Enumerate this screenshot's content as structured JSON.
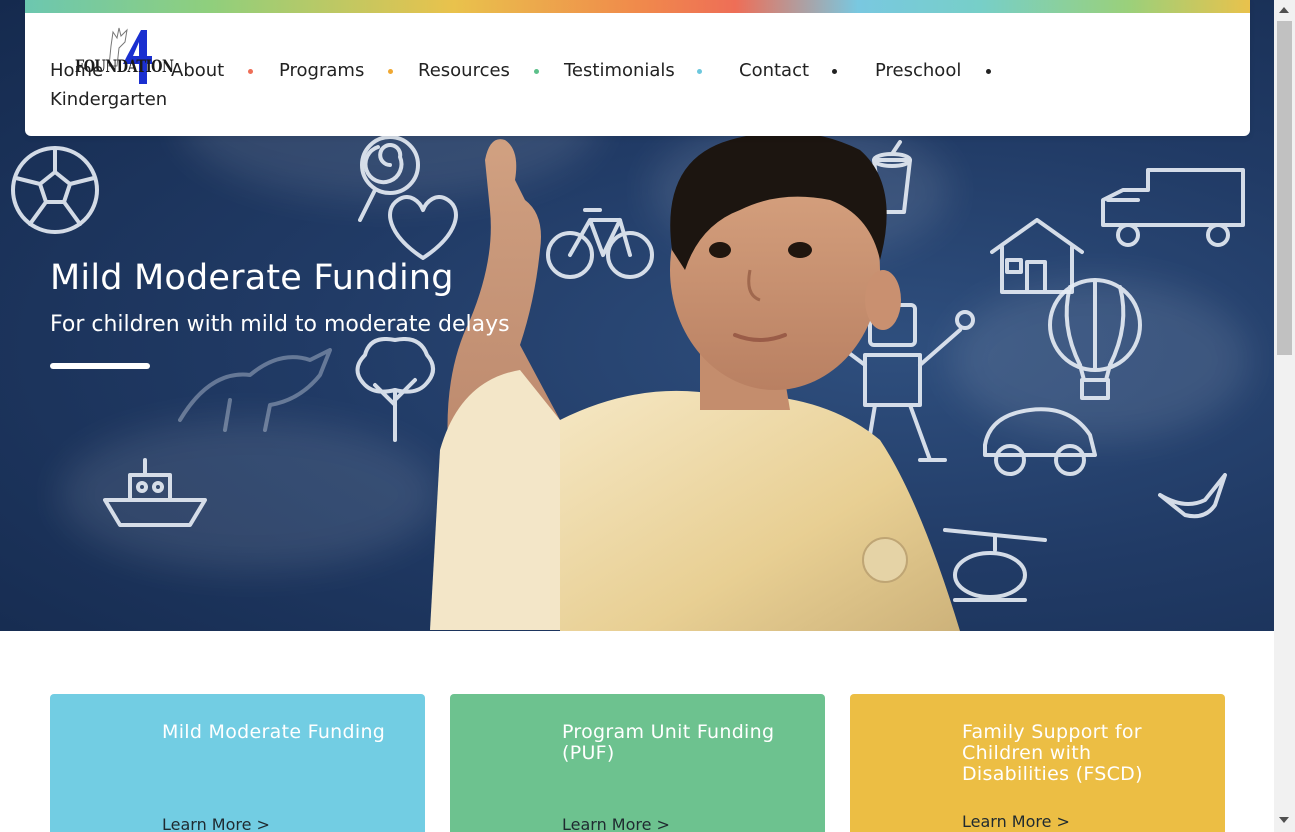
{
  "logo": {
    "text": "FOUNDATION",
    "numeral": "4"
  },
  "nav": {
    "items": [
      "Home",
      "About",
      "Programs",
      "Resources",
      "Testimonials",
      "Contact",
      "Preschool",
      "Kindergarten"
    ],
    "dot_colors": [
      "#ee6e57",
      "#f0a832",
      "#5cc08a",
      "#6cc7dd",
      "#222222",
      "#222222"
    ]
  },
  "hero": {
    "title": "Mild Moderate Funding",
    "subtitle": "For children with mild to moderate delays"
  },
  "cards": [
    {
      "title": "Mild Moderate Funding",
      "link": "Learn More >",
      "color": "#72cde3"
    },
    {
      "title": "Program Unit Funding (PUF)",
      "link": "Learn More >",
      "color": "#6dc28f"
    },
    {
      "title": "Family Support for Children with Disabilities (FSCD)",
      "link": "Learn More >",
      "color": "#ecbe44"
    }
  ]
}
